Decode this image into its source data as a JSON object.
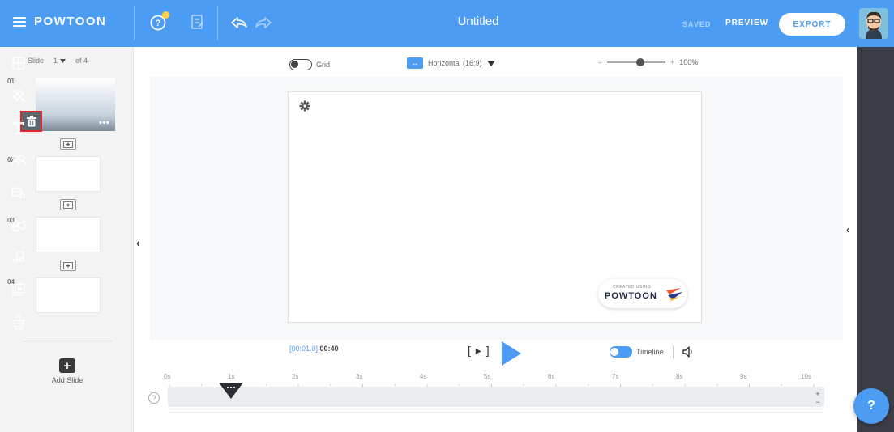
{
  "header": {
    "brand": "POWTOON",
    "title": "Untitled",
    "saved": "SAVED",
    "preview": "PREVIEW",
    "export": "EXPORT",
    "brand_color": "#4d9cf4"
  },
  "slides_panel": {
    "slide_label": "Slide",
    "current": "1",
    "of_label": "of 4",
    "slides": [
      {
        "num": "01"
      },
      {
        "num": "02"
      },
      {
        "num": "03"
      },
      {
        "num": "04"
      }
    ],
    "more": "•••",
    "add_slide": "Add Slide"
  },
  "toolbar": {
    "grid": "Grid",
    "orientation": "Horizontal (16:9)",
    "zoom": "100%"
  },
  "canvas": {
    "watermark_small": "CREATED USING",
    "watermark_brand": "POWTOON"
  },
  "playback": {
    "current_time": "[00:01.0]",
    "total_time": "00:40",
    "timeline_label": "Timeline",
    "step_label": "[ ▸ ]"
  },
  "timeline": {
    "ticks": [
      "0s",
      "1s",
      "2s",
      "3s",
      "4s",
      "5s",
      "6s",
      "7s",
      "8s",
      "9s",
      "10s"
    ],
    "zoom_in": "+",
    "zoom_out": "−",
    "help": "?"
  },
  "help_fab": "?",
  "icons": {
    "menu": "hamburger-icon",
    "help": "help-icon",
    "notes": "notes-icon",
    "undo": "undo-icon",
    "redo": "redo-icon",
    "layouts": "layouts-icon",
    "backgrounds": "background-icon",
    "text": "text-icon",
    "characters": "characters-icon",
    "props": "props-icon",
    "shapes": "shapes-icon",
    "music": "music-icon",
    "media": "media-icon",
    "special": "special-icon"
  }
}
